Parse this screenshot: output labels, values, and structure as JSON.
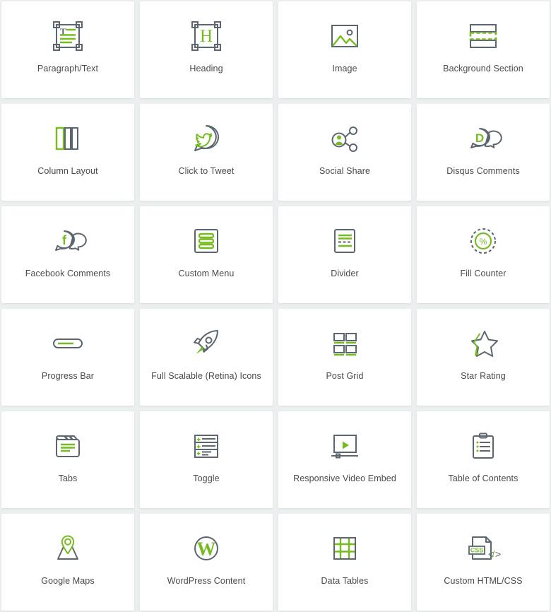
{
  "grid": {
    "columns": 4,
    "rows": 6,
    "background_color": "#eceff0",
    "card_background_color": "#ffffff",
    "accent_color": "#76bc21",
    "outline_color": "#5c6670",
    "label_color": "#4a4a4a"
  },
  "features": [
    {
      "label": "Paragraph/Text",
      "icon": "paragraph-text-icon"
    },
    {
      "label": "Heading",
      "icon": "heading-icon"
    },
    {
      "label": "Image",
      "icon": "image-icon"
    },
    {
      "label": "Background Section",
      "icon": "background-section-icon"
    },
    {
      "label": "Column Layout",
      "icon": "column-layout-icon"
    },
    {
      "label": "Click to Tweet",
      "icon": "twitter-bubble-icon"
    },
    {
      "label": "Social Share",
      "icon": "social-share-icon"
    },
    {
      "label": "Disqus Comments",
      "icon": "disqus-comments-icon"
    },
    {
      "label": "Facebook Comments",
      "icon": "facebook-comments-icon"
    },
    {
      "label": "Custom Menu",
      "icon": "custom-menu-icon"
    },
    {
      "label": "Divider",
      "icon": "divider-icon"
    },
    {
      "label": "Fill Counter",
      "icon": "fill-counter-icon"
    },
    {
      "label": "Progress Bar",
      "icon": "progress-bar-icon"
    },
    {
      "label": "Full Scalable (Retina) Icons",
      "icon": "rocket-icon"
    },
    {
      "label": "Post Grid",
      "icon": "post-grid-icon"
    },
    {
      "label": "Star Rating",
      "icon": "star-rating-icon"
    },
    {
      "label": "Tabs",
      "icon": "tabs-folder-icon"
    },
    {
      "label": "Toggle",
      "icon": "toggle-list-icon"
    },
    {
      "label": "Responsive Video Embed",
      "icon": "video-embed-icon"
    },
    {
      "label": "Table of Contents",
      "icon": "clipboard-list-icon"
    },
    {
      "label": "Google Maps",
      "icon": "map-pin-icon"
    },
    {
      "label": "WordPress Content",
      "icon": "wordpress-icon"
    },
    {
      "label": "Data Tables",
      "icon": "data-table-icon"
    },
    {
      "label": "Custom HTML/CSS",
      "icon": "custom-html-css-icon"
    }
  ]
}
